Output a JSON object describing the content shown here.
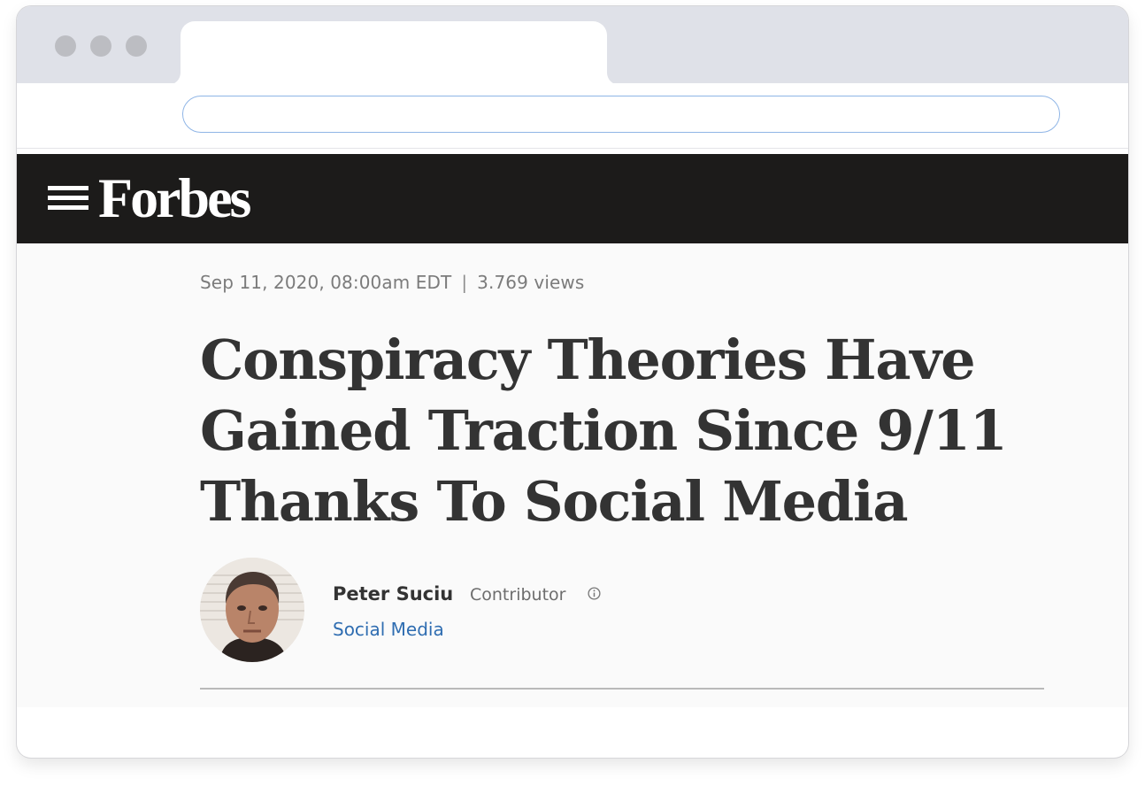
{
  "browser": {
    "address_value": ""
  },
  "site": {
    "logo_text": "Forbes",
    "bar_color": "#1c1b1a"
  },
  "article": {
    "date": "Sep 11, 2020, 08:00am EDT",
    "separator": "|",
    "views": "3.769 views",
    "headline": "Conspiracy Theories Have Gained Traction Since 9/11 Thanks To Social Media",
    "author": {
      "name": "Peter Suciu",
      "role": "Contributor",
      "channel": "Social Media"
    }
  },
  "colors": {
    "link": "#2f6db1",
    "headline": "#333333",
    "meta": "#7b7b7b"
  }
}
